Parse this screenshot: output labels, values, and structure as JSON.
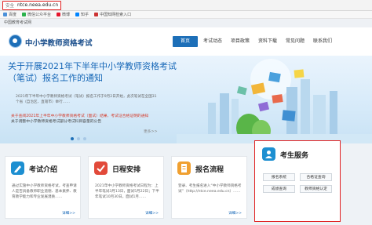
{
  "browser": {
    "security_label": "安全",
    "url": "ntce.neea.edu.cn",
    "bookmarks": [
      "百度",
      "微信公众平台",
      "微博",
      "知乎",
      "中国知网检索入口"
    ]
  },
  "top_strip": {
    "text": "中国教育考试网"
  },
  "header": {
    "site_title": "中小学教师资格考试",
    "nav": [
      "首页",
      "考试动态",
      "项目政策",
      "资料下载",
      "常见问题",
      "联系我们"
    ],
    "active_nav": "首页"
  },
  "hero": {
    "headline": "关于开展2021年下半年中小学教师资格考试（笔试）报名工作的通知",
    "summary": "2021年下半年中小学教师资格考试（笔试）报名工作于9月2日开始，此次笔试在全国31个省（自治区、直辖市）举行……",
    "link_1": "关于查阅2021年上半年中小学教师资格考试（面试）结果、考试证合格证明的通知",
    "link_2": "关于调整中小学教师资格考试部分考试科目容量的公告",
    "more": "更多>>"
  },
  "cards": [
    {
      "title": "考试介绍",
      "desc": "通过实施中小学教师资格考试，考查申请人是否具备教师职业道德、基本素养、教育教学能力和专业发展潜质……",
      "detail": "详细>>"
    },
    {
      "title": "日程安排",
      "desc": "2021年中小学教师资格考试日程为：上半年笔试3月13日，面试5月22日；下半年笔试10月30日，面试1月……",
      "detail": "详细>>"
    },
    {
      "title": "报名流程",
      "desc": "登录、考生报名进入“中小学教师资格考试”（http://ntce.neea.edu.cn）……",
      "detail": "详细>>"
    }
  ],
  "services": {
    "title": "考生服务",
    "buttons": [
      "报名系统",
      "合格证查询",
      "成绩查询",
      "教师资格认定"
    ]
  },
  "colors": {
    "brand_blue": "#1d6fb8",
    "highlight_red": "#e02020"
  }
}
